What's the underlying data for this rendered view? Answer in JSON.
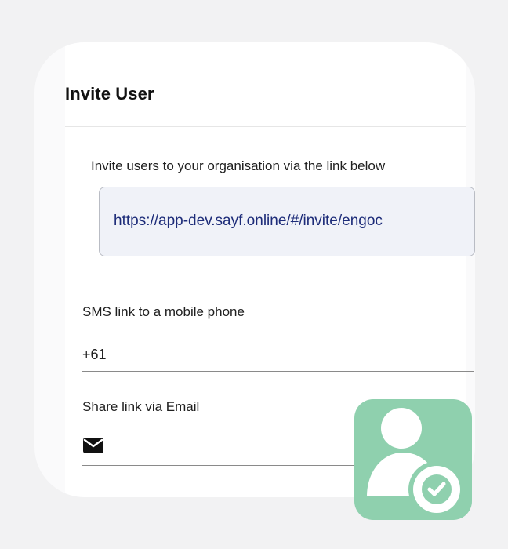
{
  "dialog": {
    "title": "Invite User",
    "invite_description": "Invite users to your organisation via the link below",
    "invite_link": "https://app-dev.sayf.online/#/invite/engoc",
    "sms_label": "SMS link to a mobile phone",
    "phone_value": "+61",
    "email_label": "Share link via Email",
    "email_icon": "mail-icon"
  },
  "badge": {
    "icon": "user-check-icon"
  },
  "colors": {
    "background": "#f2f2f3",
    "card": "#fafafb",
    "link_box_bg": "#f0f2f8",
    "link_text": "#1d2c79",
    "badge": "#8fd0ae"
  }
}
